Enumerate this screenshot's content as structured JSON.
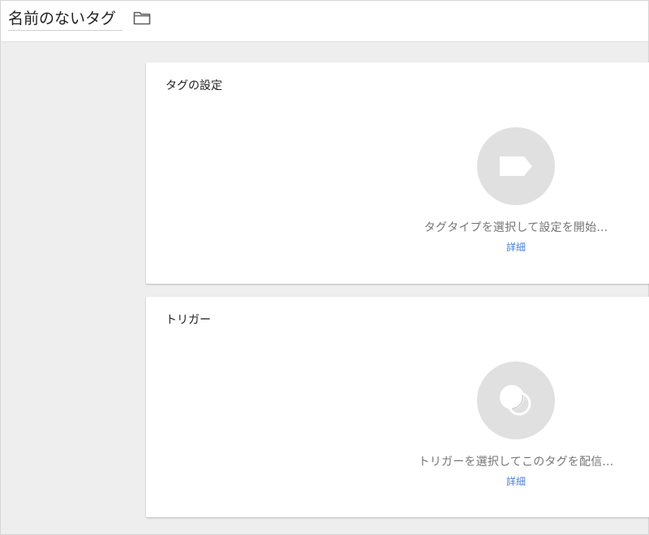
{
  "header": {
    "tag_name": "名前のないタグ",
    "folder_icon": "folder-icon"
  },
  "tag_config": {
    "title": "タグの設定",
    "icon": "tag-label-icon",
    "prompt": "タグタイプを選択して設定を開始...",
    "details_link": "詳細"
  },
  "triggering": {
    "title": "トリガー",
    "icon": "trigger-circles-icon",
    "prompt": "トリガーを選択してこのタグを配信...",
    "details_link": "詳細"
  },
  "colors": {
    "background": "#eeeeee",
    "card": "#ffffff",
    "icon_circle": "#e0e0e0",
    "link": "#4a7fd9",
    "secondary_text": "#757575"
  }
}
